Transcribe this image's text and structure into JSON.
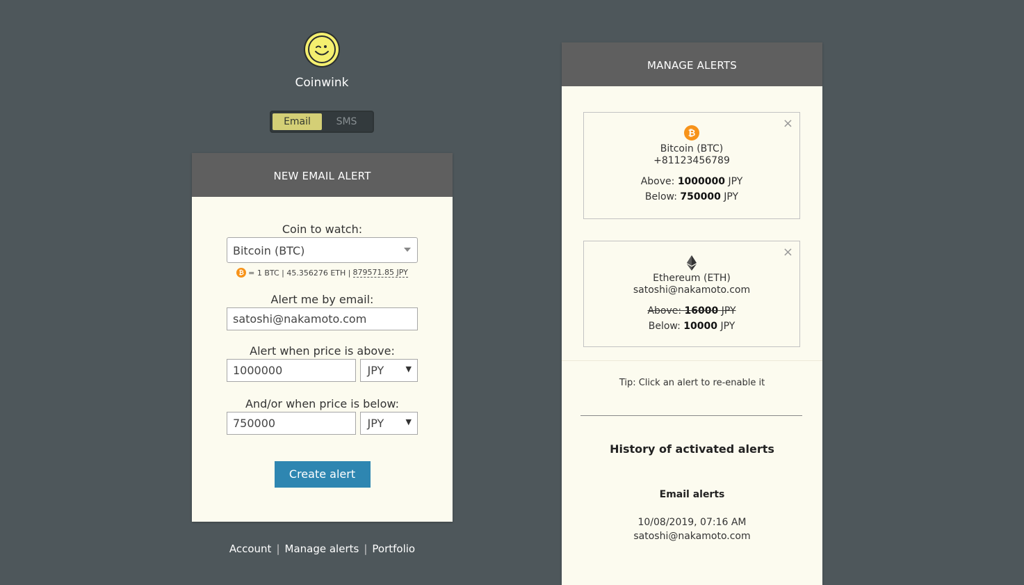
{
  "app": {
    "brand": "Coinwink"
  },
  "toggle": {
    "email_label": "Email",
    "sms_label": "SMS",
    "active": "Email"
  },
  "new_alert": {
    "header": "NEW EMAIL ALERT",
    "coin_label": "Coin to watch:",
    "coin_value": "Bitcoin (BTC)",
    "rate": {
      "btc": "= 1 BTC | 45.356276 ETH | ",
      "jpy": "879571.85 JPY"
    },
    "email_label": "Alert me by email:",
    "email_value": "satoshi@nakamoto.com",
    "above_label": "Alert when price is above:",
    "above_value": "1000000",
    "above_currency": "JPY",
    "below_label": "And/or when price is below:",
    "below_value": "750000",
    "below_currency": "JPY",
    "create_label": "Create alert"
  },
  "footer": {
    "account": "Account",
    "manage": "Manage alerts",
    "portfolio": "Portfolio",
    "sep": "|"
  },
  "manage": {
    "header": "MANAGE ALERTS",
    "alerts": [
      {
        "coin": "Bitcoin (BTC)",
        "contact": "+81123456789",
        "above_prefix": "Above:",
        "above_value": "1000000",
        "above_currency": "JPY",
        "below_prefix": "Below:",
        "below_value": "750000",
        "below_currency": "JPY"
      },
      {
        "coin": "Ethereum (ETH)",
        "contact": "satoshi@nakamoto.com",
        "above_prefix": "Above:",
        "above_value": "16000",
        "above_currency": "JPY",
        "below_prefix": "Below:",
        "below_value": "10000",
        "below_currency": "JPY"
      }
    ],
    "close_glyph": "×",
    "tip": "Tip: Click an alert to re-enable it",
    "history_title": "History of activated alerts",
    "history_sub": "Email alerts",
    "history_entry": {
      "time": "10/08/2019, 07:16 AM",
      "email": "satoshi@nakamoto.com"
    }
  },
  "colors": {
    "background": "#4e575b",
    "card": "#fcfbef",
    "card_header": "#5f5f5f",
    "toggle_active": "#d4cf76",
    "button": "#2e86b1",
    "bitcoin": "#f7931a",
    "logo": "#f4ef6f"
  },
  "icons": {
    "logo": "wink-smiley-icon",
    "btc": "bitcoin-icon",
    "eth": "ethereum-icon"
  }
}
